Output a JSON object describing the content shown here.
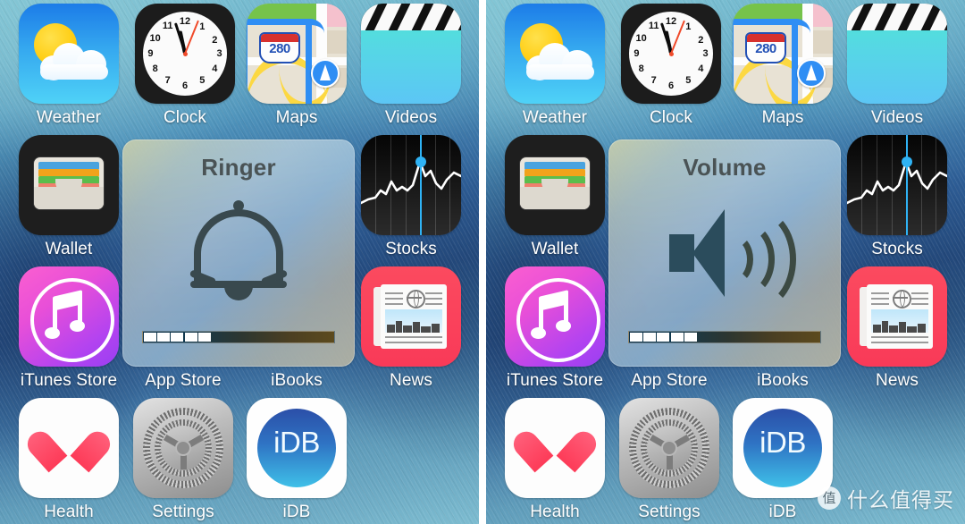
{
  "screen": {
    "title": "iOS Home Screen HUD comparison",
    "wallpaper_colors": [
      "#7cc3d4",
      "#2e5e97",
      "#274f85"
    ]
  },
  "watermark": {
    "badge": "值",
    "text": "什么值得买"
  },
  "apps": [
    {
      "name": "Weather",
      "label": "Weather",
      "icon": "weather-icon",
      "row": 0,
      "col": 0
    },
    {
      "name": "Clock",
      "label": "Clock",
      "icon": "clock-icon",
      "row": 0,
      "col": 1
    },
    {
      "name": "Maps",
      "label": "Maps",
      "icon": "maps-icon",
      "row": 0,
      "col": 2
    },
    {
      "name": "Videos",
      "label": "Videos",
      "icon": "videos-icon",
      "row": 0,
      "col": 3
    },
    {
      "name": "Wallet",
      "label": "Wallet",
      "icon": "wallet-icon",
      "row": 1,
      "col": 0
    },
    {
      "name": "Stocks",
      "label": "Stocks",
      "icon": "stocks-icon",
      "row": 1,
      "col": 3
    },
    {
      "name": "iTunes Store",
      "label": "iTunes Store",
      "icon": "itunes-store-icon",
      "row": 2,
      "col": 0
    },
    {
      "name": "App Store",
      "label": "App Store",
      "icon": "app-store-icon",
      "row": 2,
      "col": 1
    },
    {
      "name": "iBooks",
      "label": "iBooks",
      "icon": "ibooks-icon",
      "row": 2,
      "col": 2
    },
    {
      "name": "News",
      "label": "News",
      "icon": "news-icon",
      "row": 2,
      "col": 3
    },
    {
      "name": "Health",
      "label": "Health",
      "icon": "health-icon",
      "row": 3,
      "col": 0
    },
    {
      "name": "Settings",
      "label": "Settings",
      "icon": "settings-icon",
      "row": 3,
      "col": 1
    },
    {
      "name": "iDB",
      "label": "iDB",
      "icon": "idb-icon",
      "row": 3,
      "col": 2
    }
  ],
  "clock": {
    "hour_numbers": [
      "12",
      "1",
      "2",
      "3",
      "4",
      "5",
      "6",
      "7",
      "8",
      "9",
      "10",
      "11"
    ],
    "hour_angle": -12,
    "minute_angle": -18,
    "second_angle": 22
  },
  "maps": {
    "highway_shield": "280"
  },
  "idb": {
    "wordmark": "iDB"
  },
  "hud_left": {
    "title": "Ringer",
    "glyph": "bell-icon",
    "segments_total": 16,
    "segments_filled": 5,
    "level_percent": 31
  },
  "hud_right": {
    "title": "Volume",
    "glyph": "speaker-wave-icon",
    "segments_total": 16,
    "segments_filled": 5,
    "level_percent": 31
  }
}
